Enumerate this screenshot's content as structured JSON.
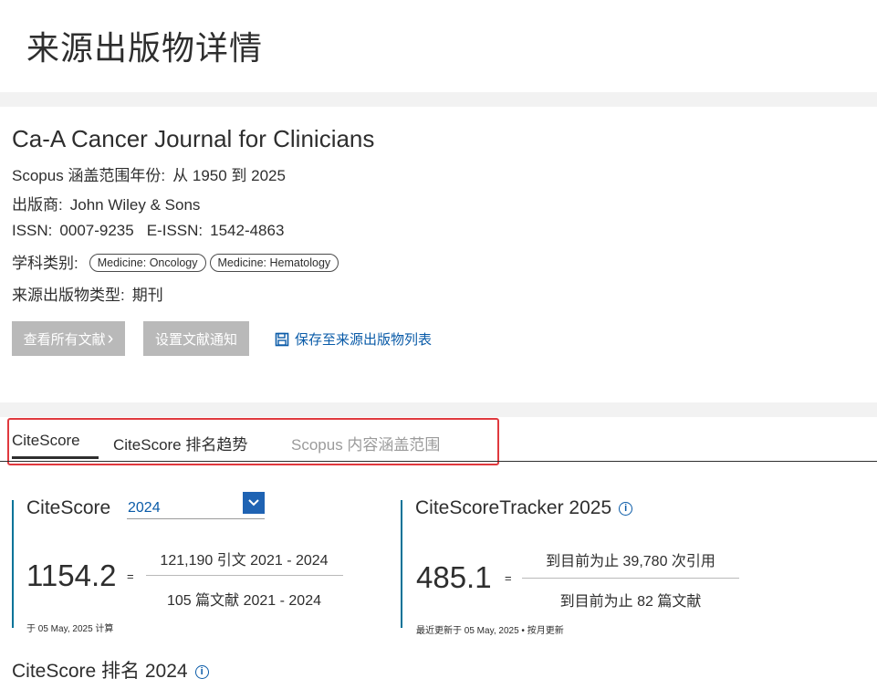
{
  "page": {
    "title": "来源出版物详情"
  },
  "journal": {
    "title": "Ca-A Cancer Journal for Clinicians",
    "coverage_label": "Scopus 涵盖范围年份:",
    "coverage_value": "从 1950 到 2025",
    "publisher_label": "出版商:",
    "publisher_value": "John Wiley & Sons",
    "issn_label": "ISSN:",
    "issn_value": "0007-9235",
    "eissn_label": "E-ISSN:",
    "eissn_value": "1542-4863",
    "subject_label": "学科类别:",
    "subjects": [
      "Medicine: Oncology",
      "Medicine: Hematology"
    ],
    "type_label": "来源出版物类型:",
    "type_value": "期刊"
  },
  "actions": {
    "view_all": "查看所有文献",
    "view_all_chevron": "›",
    "set_alert": "设置文献通知",
    "save_to_list": "保存至来源出版物列表"
  },
  "tabs": [
    {
      "label": "CiteScore",
      "active": true
    },
    {
      "label": "CiteScore 排名趋势",
      "active": false
    },
    {
      "label": "Scopus 内容涵盖范围",
      "active": false,
      "disabled": true
    }
  ],
  "citescore": {
    "title": "CiteScore",
    "year": "2024",
    "value": "1154.2",
    "equals": "=",
    "numerator": "121,190 引文 2021 - 2024",
    "denominator": "105 篇文献 2021 - 2024",
    "note": "于 05 May, 2025 计算"
  },
  "tracker": {
    "title": "CiteScoreTracker 2025",
    "info_symbol": "i",
    "value": "485.1",
    "equals": "=",
    "numerator": "到目前为止 39,780 次引用",
    "denominator": "到目前为止 82 篇文献",
    "note": "最近更新于 05 May, 2025 • 按月更新"
  },
  "rank": {
    "title": "CiteScore 排名 2024",
    "info_symbol": "i"
  },
  "colors": {
    "accent_blue": "#0a5ba8",
    "teal_bar": "#007398",
    "highlight_red": "#e0393e",
    "button_grey": "#b9b9b9"
  },
  "icons": {
    "save": "save-icon",
    "dropdown": "chevron-down-icon",
    "info": "info-icon"
  }
}
